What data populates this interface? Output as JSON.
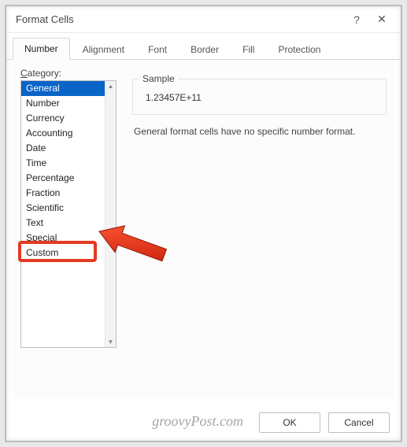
{
  "window": {
    "title": "Format Cells",
    "help_icon": "?",
    "close_icon": "✕"
  },
  "tabs": [
    {
      "label": "Number",
      "active": true
    },
    {
      "label": "Alignment",
      "active": false
    },
    {
      "label": "Font",
      "active": false
    },
    {
      "label": "Border",
      "active": false
    },
    {
      "label": "Fill",
      "active": false
    },
    {
      "label": "Protection",
      "active": false
    }
  ],
  "category": {
    "label_pre": "C",
    "label_rest": "ategory:",
    "items": [
      {
        "label": "General",
        "selected": true
      },
      {
        "label": "Number"
      },
      {
        "label": "Currency"
      },
      {
        "label": "Accounting"
      },
      {
        "label": "Date"
      },
      {
        "label": "Time"
      },
      {
        "label": "Percentage"
      },
      {
        "label": "Fraction"
      },
      {
        "label": "Scientific"
      },
      {
        "label": "Text"
      },
      {
        "label": "Special"
      },
      {
        "label": "Custom"
      }
    ]
  },
  "sample": {
    "legend": "Sample",
    "value": "1.23457E+11"
  },
  "description": "General format cells have no specific number format.",
  "buttons": {
    "ok": "OK",
    "cancel": "Cancel"
  },
  "watermark": "groovyPost.com",
  "annotation": {
    "highlight_target": "Custom"
  }
}
